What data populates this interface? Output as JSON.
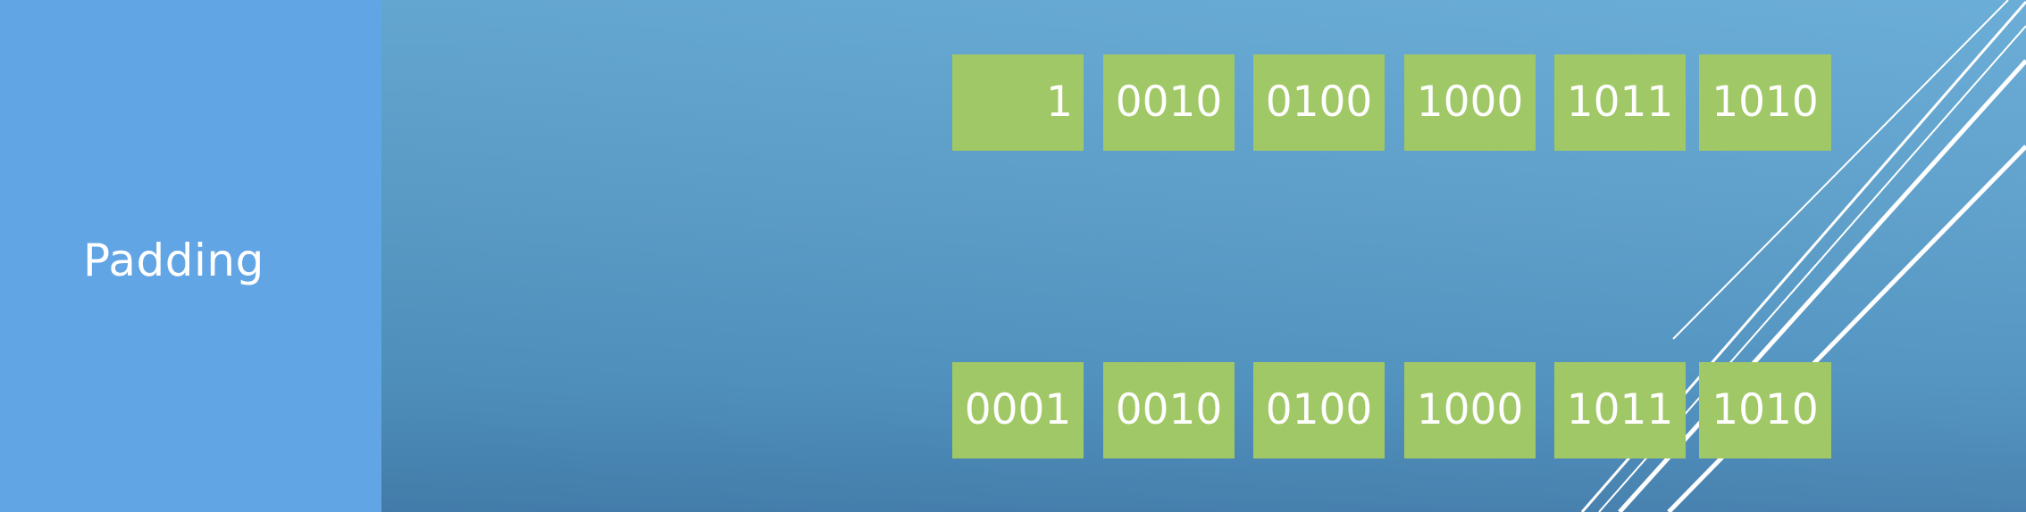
{
  "sidebar": {
    "title": "Padding"
  },
  "diagram": {
    "top_row": [
      "1",
      "0010",
      "0100",
      "1000",
      "1011",
      "1010"
    ],
    "bottom_row": [
      "0001",
      "0010",
      "0100",
      "1000",
      "1011",
      "1010"
    ]
  },
  "colors": {
    "sidebar": "#62a5e4",
    "block": "#a1c866",
    "text": "#ffffff"
  }
}
